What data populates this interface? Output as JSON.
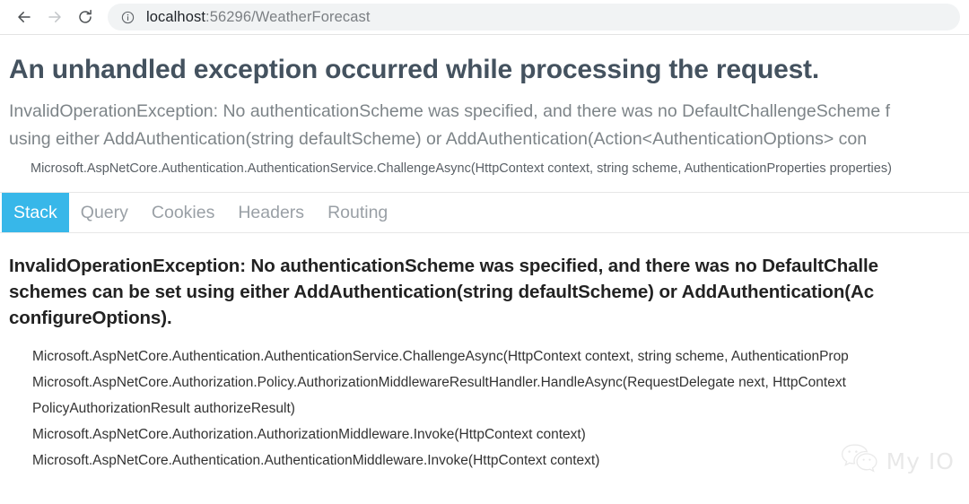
{
  "browser": {
    "back_icon": "back-arrow-icon",
    "forward_icon": "forward-arrow-icon",
    "reload_icon": "reload-icon",
    "site_info_icon": "info-circle-icon",
    "url_host": "localhost",
    "url_path": ":56296/WeatherForecast",
    "url_full": "localhost:56296/WeatherForecast"
  },
  "page": {
    "title": "An unhandled exception occurred while processing the request.",
    "exception_summary_line1": "InvalidOperationException: No authenticationScheme was specified, and there was no DefaultChallengeScheme f",
    "exception_summary_line2": "using either AddAuthentication(string defaultScheme) or AddAuthentication(Action<AuthenticationOptions> con",
    "exception_frame_top": "Microsoft.AspNetCore.Authentication.AuthenticationService.ChallengeAsync(HttpContext context, string scheme, AuthenticationProperties properties)"
  },
  "tabs": {
    "active": "Stack",
    "items": [
      {
        "label": "Stack",
        "active": true
      },
      {
        "label": "Query",
        "active": false
      },
      {
        "label": "Cookies",
        "active": false
      },
      {
        "label": "Headers",
        "active": false
      },
      {
        "label": "Routing",
        "active": false
      }
    ]
  },
  "stack": {
    "title_line1": "InvalidOperationException: No authenticationScheme was specified, and there was no DefaultChalle",
    "title_line2": "schemes can be set using either AddAuthentication(string defaultScheme) or AddAuthentication(Ac",
    "title_line3": "configureOptions).",
    "frames": [
      "Microsoft.AspNetCore.Authentication.AuthenticationService.ChallengeAsync(HttpContext context, string scheme, AuthenticationProp",
      "Microsoft.AspNetCore.Authorization.Policy.AuthorizationMiddlewareResultHandler.HandleAsync(RequestDelegate next, HttpContext ",
      "PolicyAuthorizationResult authorizeResult)",
      "Microsoft.AspNetCore.Authorization.AuthorizationMiddleware.Invoke(HttpContext context)",
      "Microsoft.AspNetCore.Authentication.AuthenticationMiddleware.Invoke(HttpContext context)"
    ]
  },
  "watermark": {
    "icon": "wechat-icon",
    "label": "My IO"
  },
  "colors": {
    "accent": "#37b7e9",
    "heading": "#44525f",
    "muted": "#7d8488",
    "frame_text": "#333333"
  }
}
